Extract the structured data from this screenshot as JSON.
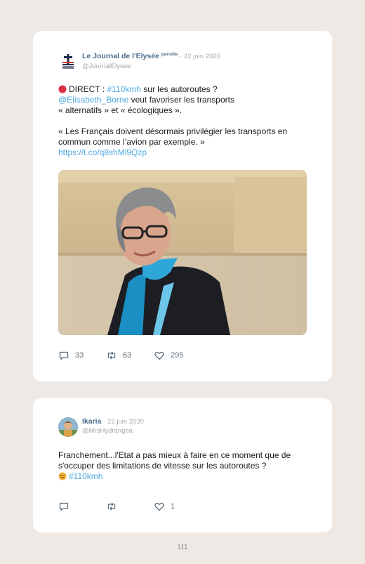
{
  "tweets": [
    {
      "author": "Le Journal de l'Elysée",
      "badge": "parodie",
      "date": "· 22 juin 2020",
      "handle": "@JournalElysee",
      "line1_prefix": "DIRECT : ",
      "line1_hashtag": "#110kmh",
      "line1_suffix": " sur les autoroutes ?",
      "line2_mention": "@Elisabeth_Borne",
      "line2_suffix": " veut favoriser les transports",
      "line3": "« alternatifs » et « écologiques ».",
      "para2": "« Les Français doivent désormais privilégier les transports en commun comme l’avion par exemple. »",
      "url": "https://t.co/q8shMi9Qzp",
      "replies": "33",
      "retweets": "63",
      "likes": "295"
    },
    {
      "author": "Ikaria",
      "date": "· 22 juin 2020",
      "handle": "@MrsHydrangea",
      "text": "Franchement...l'Etat a pas mieux à faire en ce moment que de s'occuper des limitations de vitesse sur les autoroutes ?",
      "hashtag": "#110kmh",
      "replies": "",
      "retweets": "",
      "likes": "1"
    }
  ],
  "page_number": "111"
}
